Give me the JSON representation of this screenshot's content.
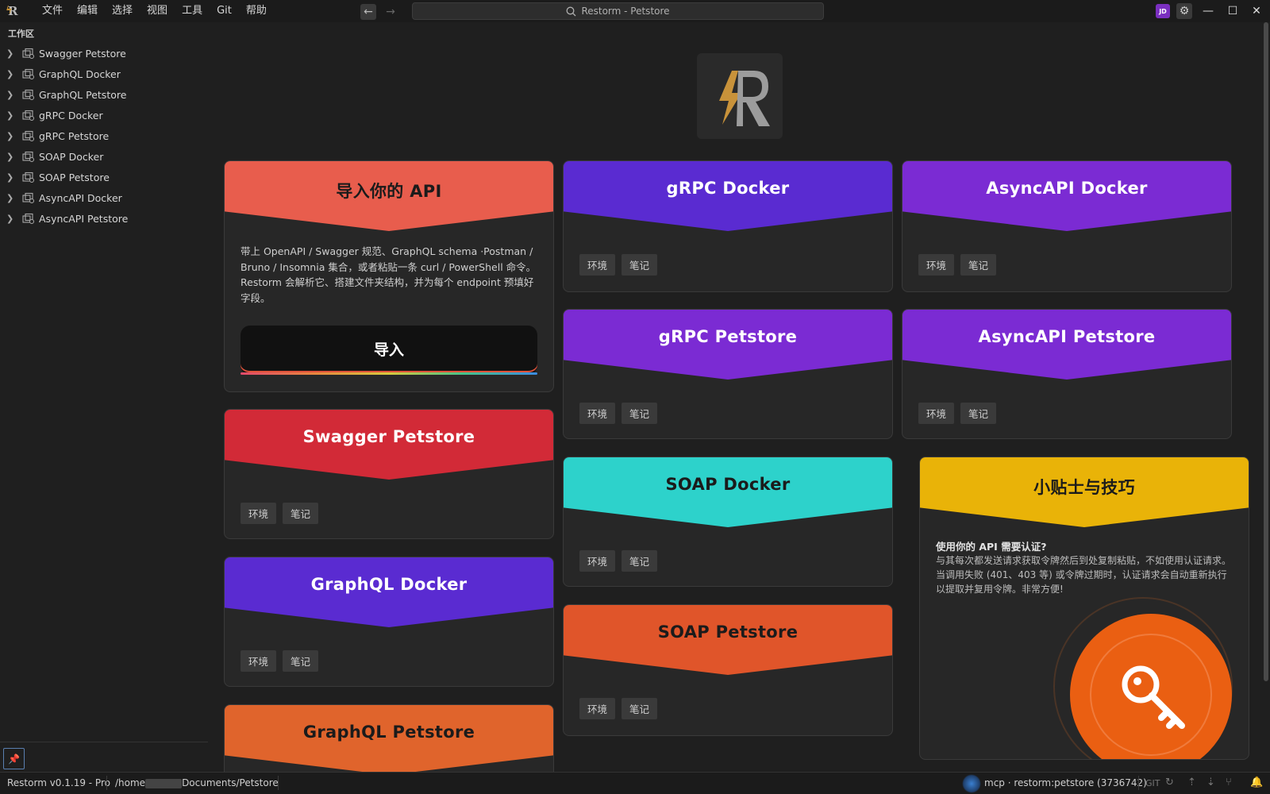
{
  "window": {
    "search_text": "Restorm - Petstore",
    "avatar_initials": "JD"
  },
  "menu": [
    "文件",
    "编辑",
    "选择",
    "视图",
    "工具",
    "Git",
    "帮助"
  ],
  "sidebar": {
    "header": "工作区",
    "items": [
      {
        "label": "Swagger Petstore"
      },
      {
        "label": "GraphQL Docker"
      },
      {
        "label": "GraphQL Petstore"
      },
      {
        "label": "gRPC Docker"
      },
      {
        "label": "gRPC Petstore"
      },
      {
        "label": "SOAP Docker"
      },
      {
        "label": "SOAP Petstore"
      },
      {
        "label": "AsyncAPI Docker"
      },
      {
        "label": "AsyncAPI Petstore"
      }
    ]
  },
  "import_card": {
    "title": "导入你的 API",
    "description": "带上 OpenAPI / Swagger 规范、GraphQL schema ·Postman / Bruno / Insomnia 集合，或者粘贴一条 curl / PowerShell 命令。Restorm 会解析它、搭建文件夹结构，并为每个 endpoint 预填好字段。",
    "button_label": "导入",
    "color": "#e85d4d"
  },
  "tag_labels": {
    "env": "环境",
    "notes": "笔记"
  },
  "collections": [
    {
      "title": "Swagger Petstore",
      "color": "#d22a37",
      "text_color": "#ffffff"
    },
    {
      "title": "GraphQL Docker",
      "color": "#5a2bd1",
      "text_color": "#ffffff"
    },
    {
      "title": "GraphQL Petstore",
      "color": "#e0642c",
      "text_color": "#1b1b1b"
    },
    {
      "title": "gRPC Docker",
      "color": "#5a2bd1",
      "text_color": "#ffffff"
    },
    {
      "title": "gRPC Petstore",
      "color": "#7b2bd3",
      "text_color": "#ffffff"
    },
    {
      "title": "SOAP Docker",
      "color": "#2dd2cb",
      "text_color": "#1b1b1b"
    },
    {
      "title": "SOAP Petstore",
      "color": "#e0552a",
      "text_color": "#1b1b1b"
    },
    {
      "title": "AsyncAPI Docker",
      "color": "#7b2bd3",
      "text_color": "#ffffff"
    },
    {
      "title": "AsyncAPI Petstore",
      "color": "#7b2bd3",
      "text_color": "#ffffff"
    }
  ],
  "tips_card": {
    "title": "小贴士与技巧",
    "heading": "使用你的 API 需要认证?",
    "body": "与其每次都发送请求获取令牌然后到处复制粘贴，不如使用认证请求。当调用失败 (401、403 等) 或令牌过期时，认证请求会自动重新执行以提取并复用令牌。非常方便!",
    "color": "#e9b308"
  },
  "statusbar": {
    "version": "Restorm v0.1.19 - Pro",
    "path_prefix": "/home",
    "path_suffix": "Documents/Petstore",
    "mcp": "mcp · restorm:petstore (3736742)",
    "git": "GIT"
  }
}
